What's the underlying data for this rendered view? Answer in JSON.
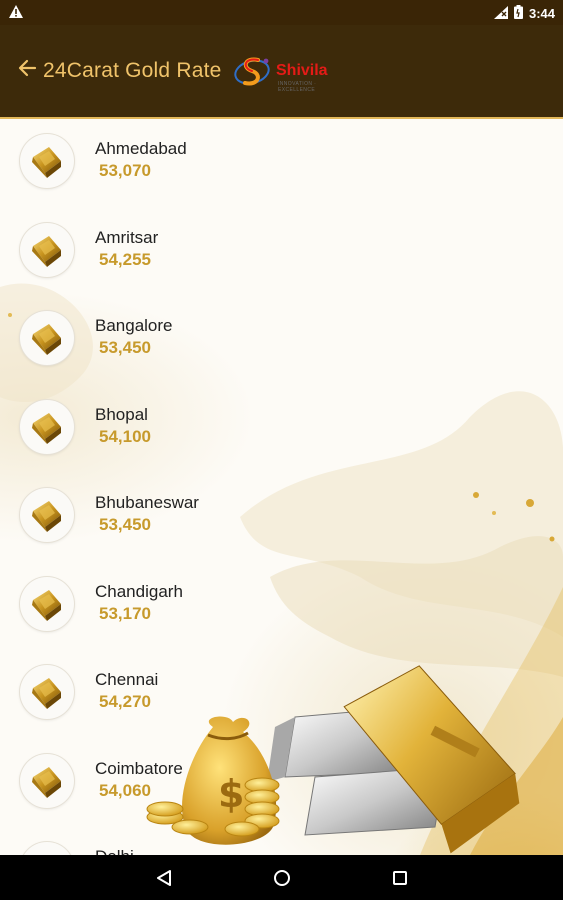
{
  "status_bar": {
    "time": "3:44",
    "icons": [
      "warning-icon",
      "wifi-off-icon",
      "battery-icon"
    ]
  },
  "app_bar": {
    "title": "24Carat Gold Rate",
    "logo": {
      "name": "Shivila",
      "tagline": "INNOVATION · EXCELLENCE"
    },
    "back_icon": "arrow-left-icon"
  },
  "colors": {
    "app_bar_bg": "#3d2a0a",
    "title_color": "#f0c36a",
    "rate_color": "#c79a2c",
    "accent_line": "#e3b85a"
  },
  "rates": [
    {
      "city": "Ahmedabad",
      "rate": "53,070"
    },
    {
      "city": "Amritsar",
      "rate": "54,255"
    },
    {
      "city": "Bangalore",
      "rate": "53,450"
    },
    {
      "city": "Bhopal",
      "rate": "54,100"
    },
    {
      "city": "Bhubaneswar",
      "rate": "53,450"
    },
    {
      "city": "Chandigarh",
      "rate": "53,170"
    },
    {
      "city": "Chennai",
      "rate": "54,270"
    },
    {
      "city": "Coimbatore",
      "rate": "54,060"
    },
    {
      "city": "Delhi",
      "rate": ""
    }
  ],
  "nav_bar": {
    "icons": [
      "back-triangle-icon",
      "home-circle-icon",
      "recents-square-icon"
    ]
  }
}
